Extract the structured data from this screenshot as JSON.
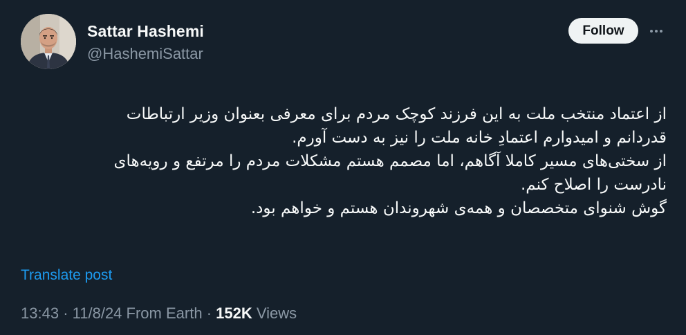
{
  "author": {
    "name": "Sattar Hashemi",
    "handle": "@HashemiSattar"
  },
  "actions": {
    "follow_label": "Follow",
    "more_icon": "more-horizontal-icon"
  },
  "post": {
    "lines": [
      "از اعتماد منتخب ملت به این فرزند کوچک مردم برای معرفی بعنوان وزیر ارتباطات",
      "قدردانم و امیدوارم اعتمادِ خانه ملت را نیز به دست آورم.",
      "از سختی‌های مسیر کاملا آگاهم، اما مصمم هستم مشکلات مردم را مرتفع و رویه‌های",
      "نادرست را اصلاح کنم.",
      "گوش شنوای متخصصان و همه‌ی شهروندان هستم و خواهم بود."
    ],
    "translate_label": "Translate post"
  },
  "meta": {
    "time": "13:43",
    "separator": "·",
    "date": "11/8/24",
    "source": "From Earth",
    "views_count": "152K",
    "views_label": "Views"
  },
  "colors": {
    "background": "#15202b",
    "text": "#f7f9f9",
    "muted": "#8b98a5",
    "link": "#1d9bf0",
    "follow_bg": "#eff3f4"
  }
}
